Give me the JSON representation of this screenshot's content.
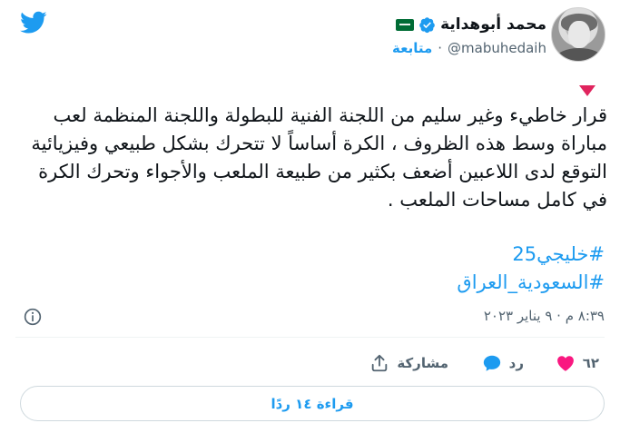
{
  "author": {
    "display_name": "محمد أبوهداية",
    "handle": "@mabuhedaih",
    "separator": "·",
    "follow_label": "متابعة",
    "verified": true
  },
  "tweet": {
    "text": "قرار خاطيء وغير سليم من اللجنة الفنية للبطولة واللجنة المنظمة لعب مباراة وسط هذه الظروف ، الكرة أساساً لا تتحرك بشكل طبيعي وفيزيائية التوقع لدى اللاعبين أضعف بكثير من طبيعة الملعب والأجواء وتحرك الكرة في كامل مساحات الملعب .",
    "hashtags": [
      "#خليجي25",
      "#السعودية_العراق"
    ],
    "timestamp": "٨:٣٩ م · ٩ يناير ٢٠٢٣"
  },
  "actions": {
    "like_count": "٦٢",
    "reply_label": "رد",
    "share_label": "مشاركة"
  },
  "read_replies_label": "قراءة ١٤ ردًا",
  "colors": {
    "accent": "#1d9bf0",
    "like": "#f91880",
    "text": "#0f1419",
    "muted": "#536471",
    "caret": "#e0245e"
  },
  "icons": [
    "twitter-logo-icon",
    "verified-badge-icon",
    "saudi-flag-icon",
    "caret-down-icon",
    "info-icon",
    "heart-icon",
    "reply-bubble-icon",
    "share-icon"
  ]
}
